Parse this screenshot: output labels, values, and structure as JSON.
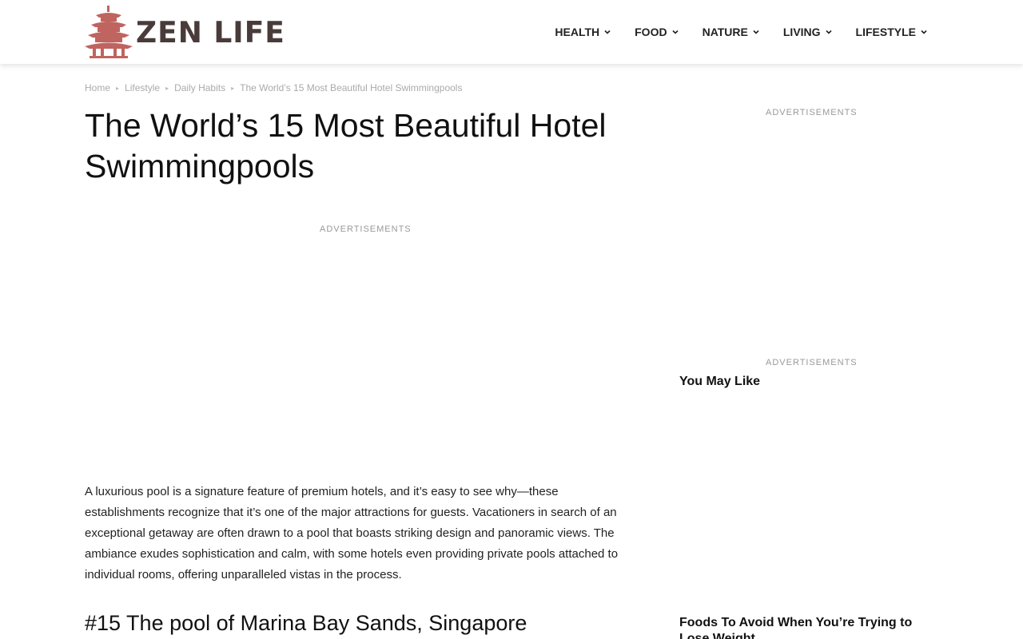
{
  "brand": {
    "name": "ZEN LIFE",
    "logo_color": "#c0645f",
    "text_color": "#4a3b3b"
  },
  "nav": {
    "items": [
      {
        "label": "HEALTH",
        "icon": "chevron-down-icon"
      },
      {
        "label": "FOOD",
        "icon": "chevron-down-icon"
      },
      {
        "label": "NATURE",
        "icon": "chevron-down-icon"
      },
      {
        "label": "LIVING",
        "icon": "chevron-down-icon"
      },
      {
        "label": "LIFESTYLE",
        "icon": "chevron-down-icon"
      }
    ]
  },
  "breadcrumb": {
    "items": [
      "Home",
      "Lifestyle",
      "Daily Habits",
      "The World’s 15 Most Beautiful Hotel Swimmingpools"
    ],
    "separator": "▸"
  },
  "article": {
    "title": "The World’s 15 Most Beautiful Hotel Swimmingpools",
    "ad_label": "ADVERTISEMENTS",
    "intro": "A luxurious pool is a signature feature of premium hotels, and it’s easy to see why—these establishments recognize that it’s one of the major attractions for guests. Vacationers in search of an exceptional getaway are often drawn to a pool that boasts striking design and panoramic views. The ambiance exudes sophistication and calm, with some hotels even providing private pools attached to individual rooms, offering unparalleled vistas in the process.",
    "first_section": "#15 The pool of Marina Bay Sands, Singapore"
  },
  "sidebar": {
    "ad_label_top": "ADVERTISEMENTS",
    "ad_label_bottom": "ADVERTISEMENTS",
    "you_may_like": "You May Like",
    "card_title": "Foods To Avoid When You’re Trying to Lose Weight"
  }
}
